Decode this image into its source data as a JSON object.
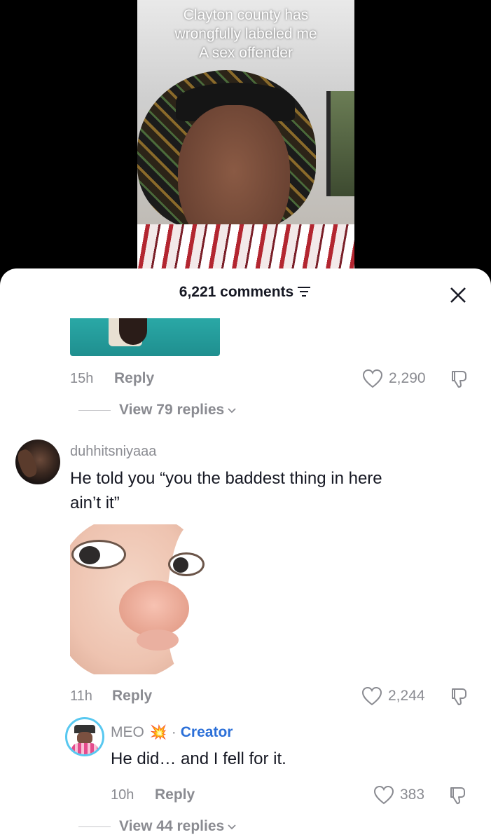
{
  "video": {
    "caption_lines": [
      "Clayton county has",
      "wrongfully labeled me",
      "A sex offender"
    ]
  },
  "sheet": {
    "comment_count": "6,221 comments"
  },
  "comments": [
    {
      "time": "15h",
      "reply_label": "Reply",
      "likes": "2,290",
      "view_replies": "View 79 replies"
    },
    {
      "username": "duhhitsniyaaa",
      "text_line1": "He told you “you the baddest thing in here",
      "text_line2": "ain’t it”",
      "time": "11h",
      "reply_label": "Reply",
      "likes": "2,244"
    },
    {
      "username": "MEO",
      "badge_emoji": "💥",
      "dot": "·",
      "creator_label": "Creator",
      "text": "He did… and I fell for it.",
      "time": "10h",
      "reply_label": "Reply",
      "likes": "383",
      "view_replies": "View 44 replies"
    }
  ],
  "colors": {
    "secondary_text": "#8a8b91",
    "primary_text": "#161823",
    "creator_blue": "#2b6fd8"
  }
}
